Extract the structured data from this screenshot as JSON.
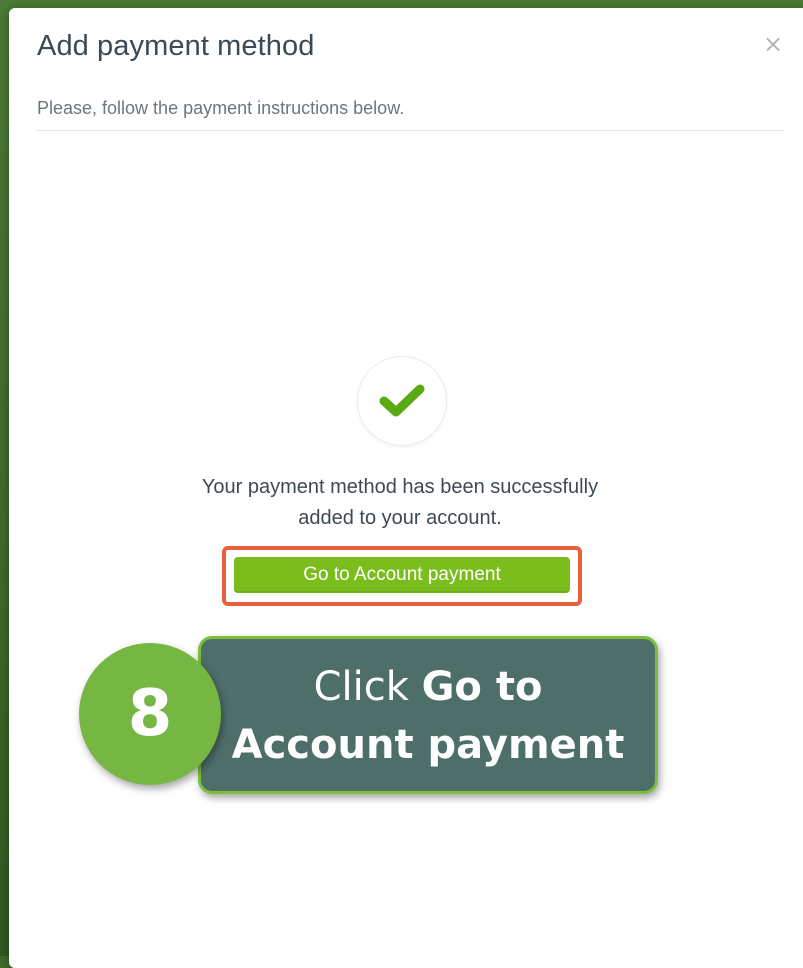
{
  "modal": {
    "title": "Add payment method",
    "close_symbol": "×",
    "subtitle": "Please, follow the payment instructions below."
  },
  "success": {
    "icon": "checkmark-icon",
    "icon_color": "#5aaa14",
    "message_line1": "Your payment method has been successfully",
    "message_line2": "added to your account.",
    "button_label": "Go to Account payment",
    "button_color": "#7cbd1e",
    "highlight_color": "#e8613c"
  },
  "callout": {
    "step_number": "8",
    "prefix": "Click ",
    "bold_part1": "Go to",
    "bold_part2": "Account payment",
    "box_color": "#4e6e6a",
    "badge_color": "#76b743"
  }
}
